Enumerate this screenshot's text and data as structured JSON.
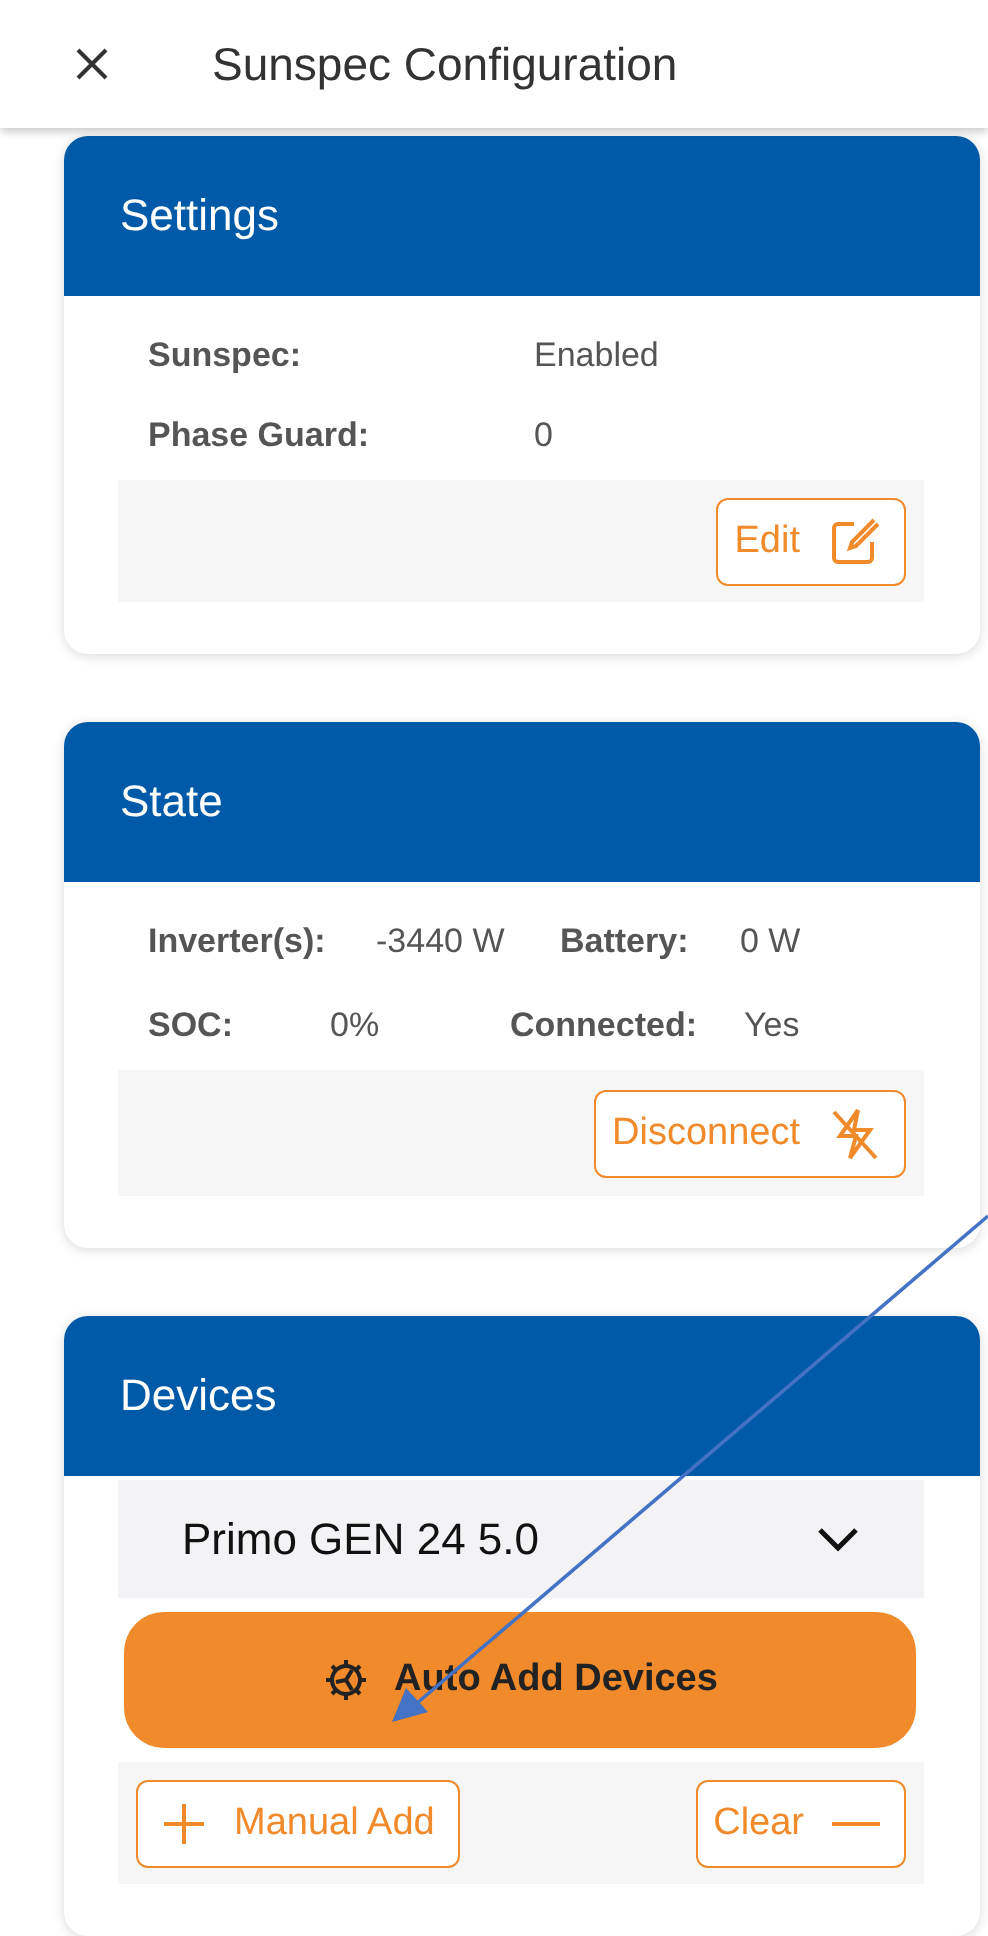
{
  "header": {
    "title": "Sunspec Configuration"
  },
  "settings": {
    "title": "Settings",
    "fields": [
      {
        "label": "Sunspec:",
        "value": "Enabled"
      },
      {
        "label": "Phase Guard:",
        "value": "0"
      }
    ],
    "edit_button": "Edit"
  },
  "state": {
    "title": "State",
    "fields": [
      {
        "label": "Inverter(s):",
        "value": "-3440 W"
      },
      {
        "label": "Battery:",
        "value": "0 W"
      },
      {
        "label": "SOC:",
        "value": "0%"
      },
      {
        "label": "Connected:",
        "value": "Yes"
      }
    ],
    "disconnect_button": "Disconnect"
  },
  "devices": {
    "title": "Devices",
    "selected_device": "Primo GEN 24 5.0",
    "auto_add_button": "Auto Add Devices",
    "manual_add_button": "Manual Add",
    "clear_button": "Clear"
  }
}
